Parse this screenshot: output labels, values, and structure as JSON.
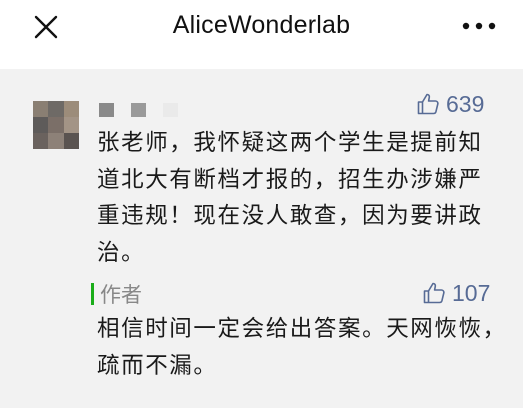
{
  "app": {
    "title": "AliceWonderlab"
  },
  "navbar": {
    "close_icon": "close-icon",
    "more_icon": "more-dots-icon"
  },
  "comment": {
    "avatar_icon": "avatar-blurred",
    "like_count": "639",
    "text": "张老师，我怀疑这两个学生是提前知道北大有断档才报的，招生办涉嫌严重违规！现在没人敢查，因为要讲政治。"
  },
  "reply": {
    "label": "作者",
    "like_count": "107",
    "text": "相信时间一定会给出答案。天网恢恢，疏而不漏。"
  },
  "colors": {
    "accent": "#576b95",
    "author_bar": "#1aad19",
    "background": "#f2f2f2"
  }
}
